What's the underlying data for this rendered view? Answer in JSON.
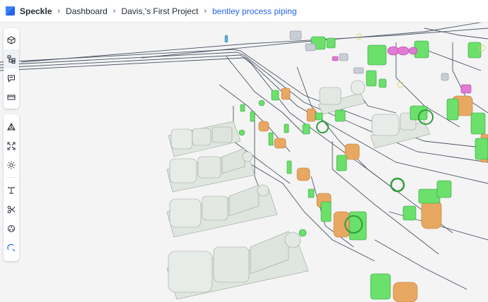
{
  "breadcrumb": {
    "app": "Speckle",
    "dashboard": "Dashboard",
    "project": "Davis,'s First Project",
    "model": "bentley process piping"
  },
  "toolbar_top": [
    {
      "icon": "cube-icon"
    },
    {
      "icon": "model-tree-icon"
    },
    {
      "icon": "comments-icon"
    },
    {
      "icon": "views-icon"
    }
  ],
  "toolbar_bottom": [
    {
      "icon": "perspective-icon"
    },
    {
      "icon": "zoom-extents-icon"
    },
    {
      "icon": "light-icon"
    },
    {
      "icon": "measure-icon"
    },
    {
      "icon": "section-cut-icon"
    },
    {
      "icon": "explode-icon"
    },
    {
      "icon": "filter-icon"
    }
  ],
  "colors": {
    "accent": "#2563eb",
    "pump_body": "#dfe5df",
    "valve_green": "#6be06b",
    "tank_orange": "#e8a862",
    "fitting_pink": "#e07ad2",
    "pipe_line": "#4b5563"
  }
}
